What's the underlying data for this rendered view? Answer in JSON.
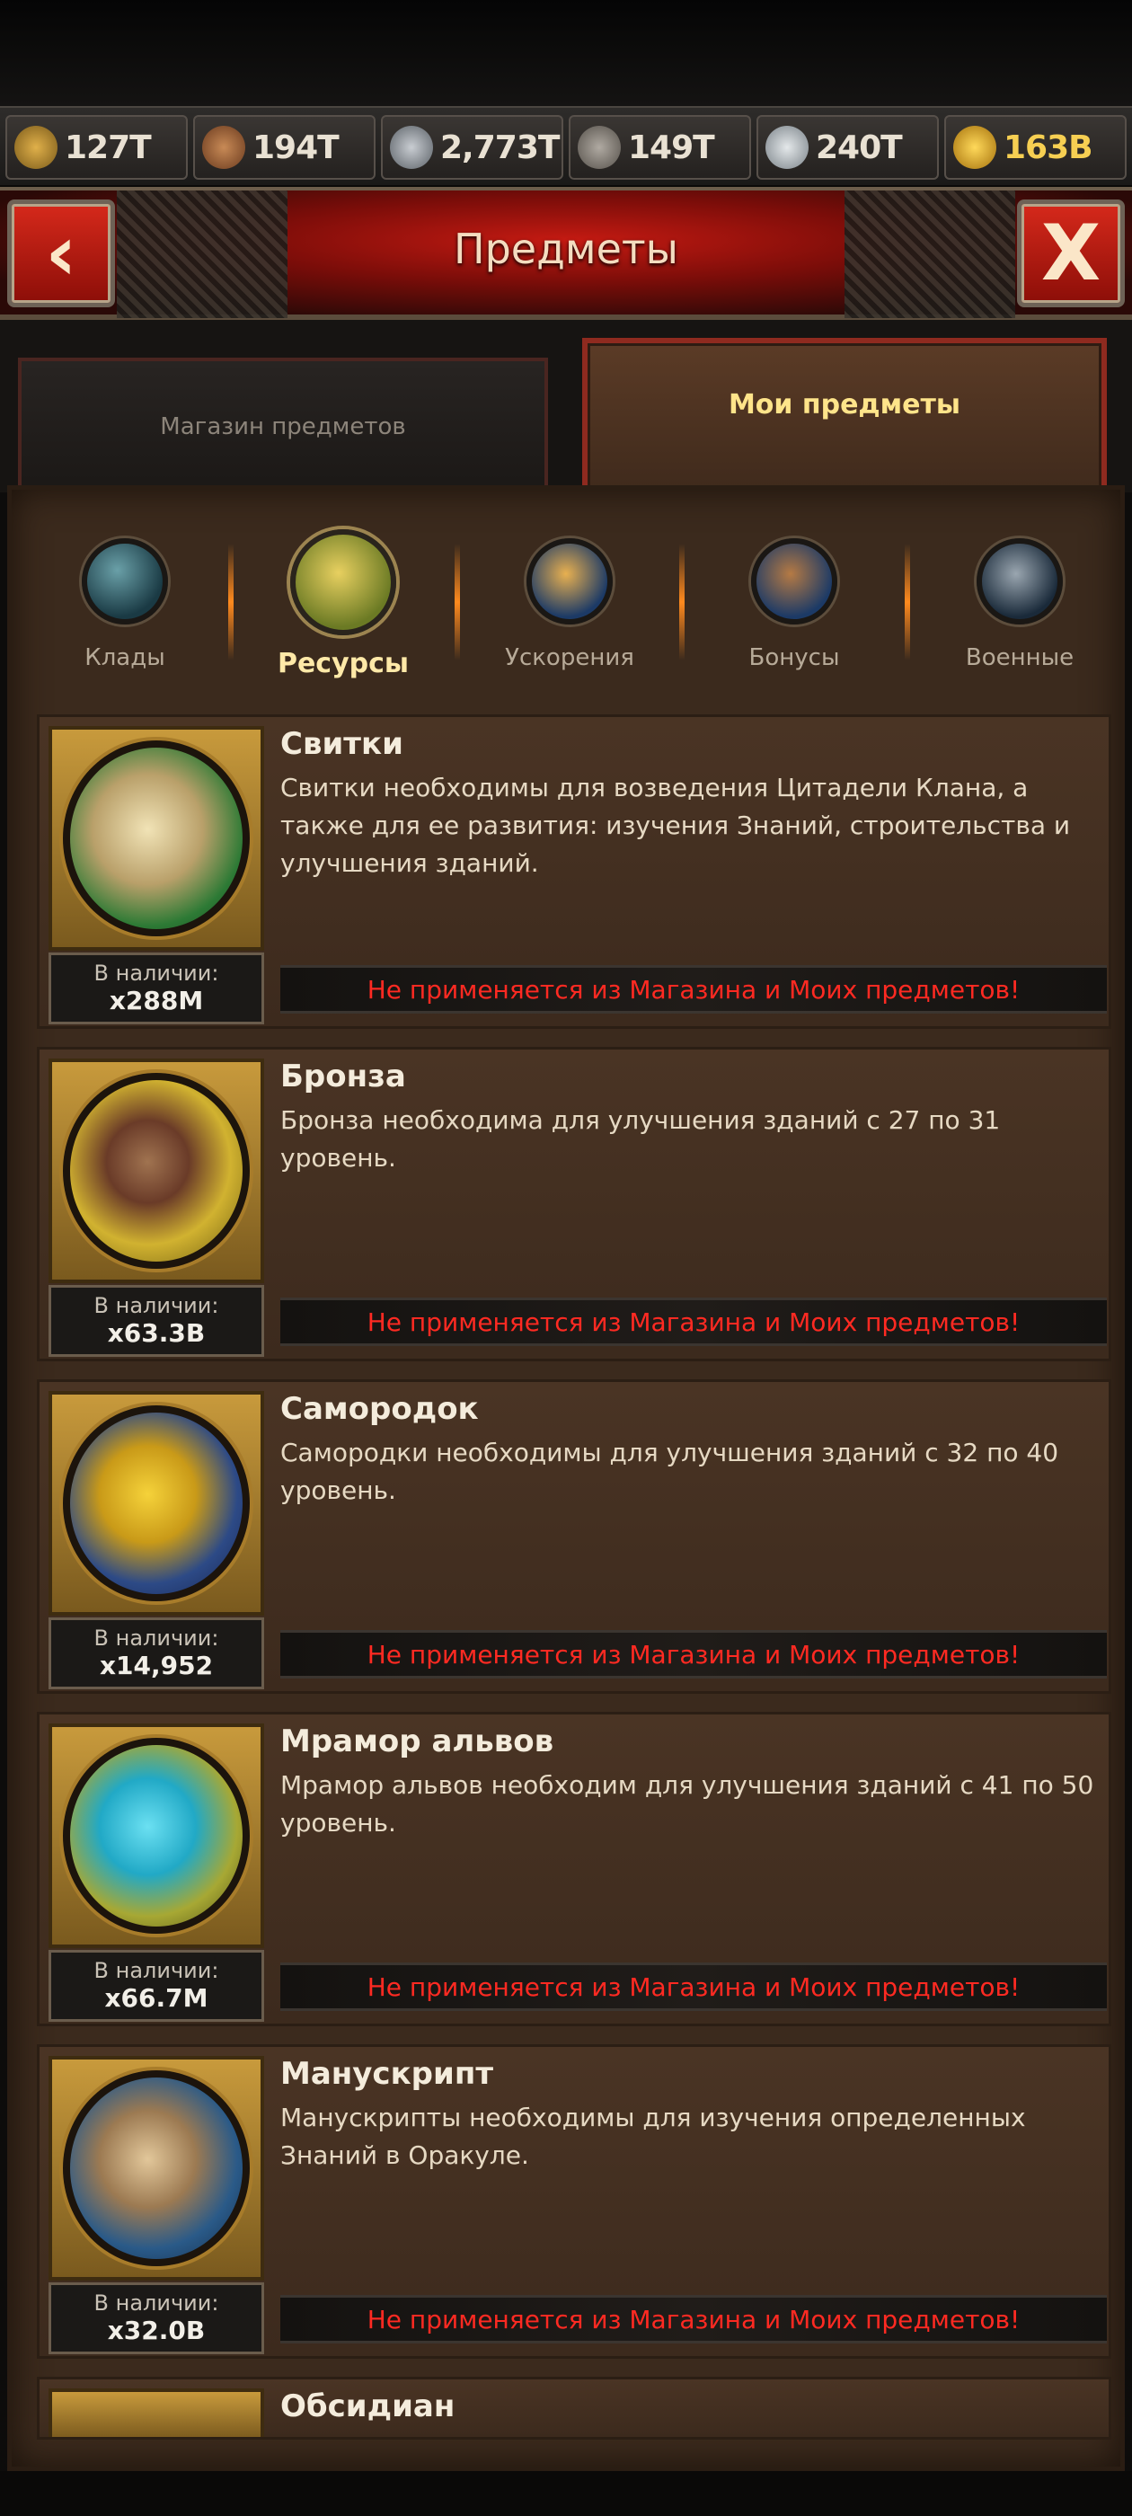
{
  "resources": [
    {
      "icon": "wheat-icon",
      "value": "127T"
    },
    {
      "icon": "wood-icon",
      "value": "194T"
    },
    {
      "icon": "iron-ingot-icon",
      "value": "2,773T"
    },
    {
      "icon": "stone-icon",
      "value": "149T"
    },
    {
      "icon": "silver-icon",
      "value": "240T"
    },
    {
      "icon": "gold-coin-icon",
      "value": "163B"
    }
  ],
  "header": {
    "title": "Предметы",
    "back_glyph": "‹",
    "close_glyph": "X"
  },
  "tabs": {
    "shop": "Магазин предметов",
    "mine": "Мои предметы"
  },
  "categories": [
    {
      "label": "Клады",
      "icon": "treasure-chest-icon"
    },
    {
      "label": "Ресурсы",
      "icon": "resources-icon",
      "active": true
    },
    {
      "label": "Ускорения",
      "icon": "hourglass-icon"
    },
    {
      "label": "Бонусы",
      "icon": "bonus-bag-icon"
    },
    {
      "label": "Военные",
      "icon": "swords-icon"
    }
  ],
  "items": [
    {
      "name": "Свитки",
      "description": "Свитки необходимы для возведения Цитадели Клана, а также для ее развития: изучения Знаний, строительства и улучшения зданий.",
      "stock_label": "В наличии:",
      "stock_value": "x288M",
      "warning": "Не применяется из Магазина и Моих предметов!"
    },
    {
      "name": "Бронза",
      "description": "Бронза необходима для улучшения зданий с 27 по 31 уровень.",
      "stock_label": "В наличии:",
      "stock_value": "x63.3B",
      "warning": "Не применяется из Магазина и Моих предметов!"
    },
    {
      "name": "Самородок",
      "description": "Самородки необходимы для улучшения зданий с 32 по 40 уровень.",
      "stock_label": "В наличии:",
      "stock_value": "x14,952",
      "warning": "Не применяется из Магазина и Моих предметов!"
    },
    {
      "name": "Мрамор альвов",
      "description": "Мрамор альвов необходим для улучшения зданий с 41 по 50 уровень.",
      "stock_label": "В наличии:",
      "stock_value": "x66.7M",
      "warning": "Не применяется из Магазина и Моих предметов!"
    },
    {
      "name": "Манускрипт",
      "description": "Манускрипты необходимы для изучения определенных Знаний в Оракуле.",
      "stock_label": "В наличии:",
      "stock_value": "x32.0B",
      "warning": "Не применяется из Магазина и Моих предметов!"
    },
    {
      "name": "Обсидиан"
    }
  ]
}
